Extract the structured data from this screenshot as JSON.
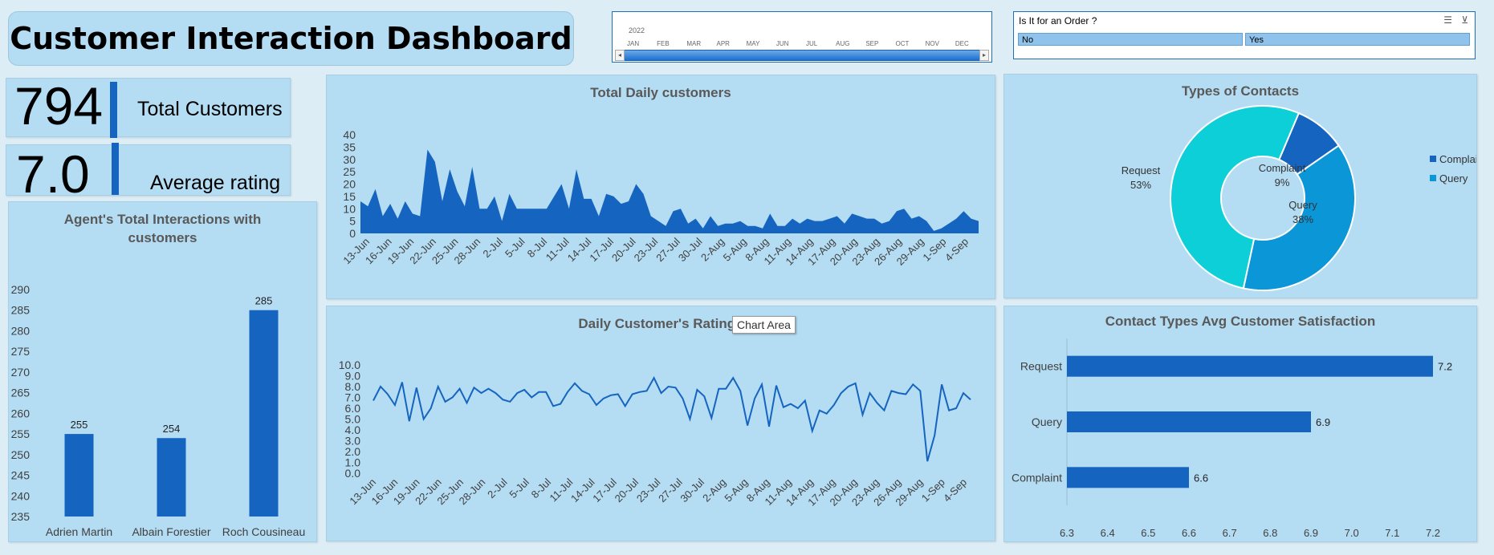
{
  "title": "Customer Interaction Dashboard",
  "kpis": {
    "total_customers_value": "794",
    "total_customers_label": "Total Customers",
    "avg_rating_value": "7.0",
    "avg_rating_label": "Average rating"
  },
  "timeline": {
    "year": "2022",
    "months": [
      "JAN",
      "FEB",
      "MAR",
      "APR",
      "MAY",
      "JUN",
      "JUL",
      "AUG",
      "SEP",
      "OCT",
      "NOV",
      "DEC"
    ]
  },
  "order_slicer": {
    "title": "Is It for an Order ?",
    "options": [
      "No",
      "Yes"
    ]
  },
  "tooltip": "Chart Area",
  "colors": {
    "dark_blue": "#1565c0",
    "mid_blue": "#0b96d8",
    "cyan": "#0dcfd8",
    "panel": "#b4dcf2"
  },
  "chart_data": [
    {
      "id": "daily_customers",
      "type": "area",
      "title": "Total Daily customers",
      "x_tick_labels": [
        "13-Jun",
        "16-Jun",
        "19-Jun",
        "22-Jun",
        "25-Jun",
        "28-Jun",
        "2-Jul",
        "5-Jul",
        "8-Jul",
        "11-Jul",
        "14-Jul",
        "17-Jul",
        "20-Jul",
        "23-Jul",
        "27-Jul",
        "30-Jul",
        "2-Aug",
        "5-Aug",
        "8-Aug",
        "11-Aug",
        "14-Aug",
        "17-Aug",
        "20-Aug",
        "23-Aug",
        "26-Aug",
        "29-Aug",
        "1-Sep",
        "4-Sep"
      ],
      "values": [
        13,
        11,
        18,
        7,
        12,
        6,
        13,
        8,
        7,
        34,
        29,
        13,
        26,
        17,
        11,
        27,
        10,
        10,
        15,
        5,
        16,
        10,
        10,
        10,
        10,
        10,
        15,
        20,
        10,
        26,
        14,
        14,
        7,
        16,
        15,
        12,
        13,
        20,
        16,
        7,
        5,
        3,
        9,
        10,
        4,
        6,
        2,
        7,
        3,
        4,
        4,
        5,
        3,
        3,
        2,
        8,
        3,
        3,
        6,
        4,
        6,
        5,
        5,
        6,
        7,
        4,
        8,
        7,
        6,
        6,
        4,
        5,
        9,
        10,
        6,
        7,
        5,
        1,
        2,
        4,
        6,
        9,
        6,
        5
      ],
      "ylim": [
        0,
        40
      ],
      "y_ticks": [
        0,
        5,
        10,
        15,
        20,
        25,
        30,
        35,
        40
      ]
    },
    {
      "id": "daily_ratings",
      "type": "line",
      "title": "Daily Customer's Ratings",
      "x_tick_labels": [
        "13-Jun",
        "16-Jun",
        "19-Jun",
        "22-Jun",
        "25-Jun",
        "28-Jun",
        "2-Jul",
        "5-Jul",
        "8-Jul",
        "11-Jul",
        "14-Jul",
        "17-Jul",
        "20-Jul",
        "23-Jul",
        "27-Jul",
        "30-Jul",
        "2-Aug",
        "5-Aug",
        "8-Aug",
        "11-Aug",
        "14-Aug",
        "17-Aug",
        "20-Aug",
        "23-Aug",
        "26-Aug",
        "29-Aug",
        "1-Sep",
        "4-Sep"
      ],
      "values": [
        6.7,
        8.0,
        7.3,
        6.3,
        8.4,
        4.8,
        7.9,
        5.0,
        6.0,
        8.0,
        6.6,
        7.0,
        7.8,
        6.5,
        7.9,
        7.4,
        7.8,
        7.4,
        6.8,
        6.6,
        7.4,
        7.7,
        7.0,
        7.5,
        7.5,
        6.2,
        6.4,
        7.5,
        8.3,
        7.6,
        7.3,
        6.3,
        6.9,
        7.2,
        7.3,
        6.2,
        7.3,
        7.5,
        7.6,
        8.8,
        7.4,
        8.0,
        7.9,
        6.9,
        5.0,
        7.7,
        7.1,
        5.1,
        7.8,
        7.8,
        8.8,
        7.6,
        4.4,
        6.9,
        8.2,
        4.3,
        8.1,
        6.1,
        6.4,
        6.0,
        6.7,
        3.9,
        5.8,
        5.5,
        6.3,
        7.4,
        8.0,
        8.3,
        5.4,
        7.4,
        6.5,
        5.8,
        7.6,
        7.4,
        7.3,
        8.2,
        7.6,
        1.1,
        3.5,
        8.2,
        5.8,
        6.0,
        7.4,
        6.8
      ],
      "ylim": [
        0,
        10
      ],
      "y_ticks": [
        0.0,
        1.0,
        2.0,
        3.0,
        4.0,
        5.0,
        6.0,
        7.0,
        8.0,
        9.0,
        10.0
      ]
    },
    {
      "id": "agent_interactions",
      "type": "bar",
      "title": "Agent's Total Interactions with customers",
      "categories": [
        "Adrien Martin",
        "Albain Forestier",
        "Roch Cousineau"
      ],
      "values": [
        255,
        254,
        285
      ],
      "ylim": [
        235,
        290
      ],
      "y_ticks": [
        235,
        240,
        245,
        250,
        255,
        260,
        265,
        270,
        275,
        280,
        285,
        290
      ]
    },
    {
      "id": "contact_types",
      "type": "pie",
      "title": "Types of Contacts",
      "slices": [
        {
          "label": "Complaint",
          "pct_label": "9%",
          "value": 9,
          "color": "#1565c0"
        },
        {
          "label": "Query",
          "pct_label": "38%",
          "value": 38,
          "color": "#0b96d8"
        },
        {
          "label": "Request",
          "pct_label": "53%",
          "value": 53,
          "color": "#0dcfd8"
        }
      ],
      "legend": [
        "Complaint",
        "Query"
      ],
      "legend_position": "right"
    },
    {
      "id": "contact_satisfaction",
      "type": "bar",
      "orientation": "horizontal",
      "title": "Contact Types Avg Customer Satisfaction",
      "categories": [
        "Request",
        "Query",
        "Complaint"
      ],
      "values": [
        7.2,
        6.9,
        6.6
      ],
      "xlim": [
        6.3,
        7.2
      ],
      "x_ticks": [
        "6.3",
        "6.4",
        "6.5",
        "6.6",
        "6.7",
        "6.8",
        "6.9",
        "7.0",
        "7.1",
        "7.2"
      ]
    }
  ]
}
